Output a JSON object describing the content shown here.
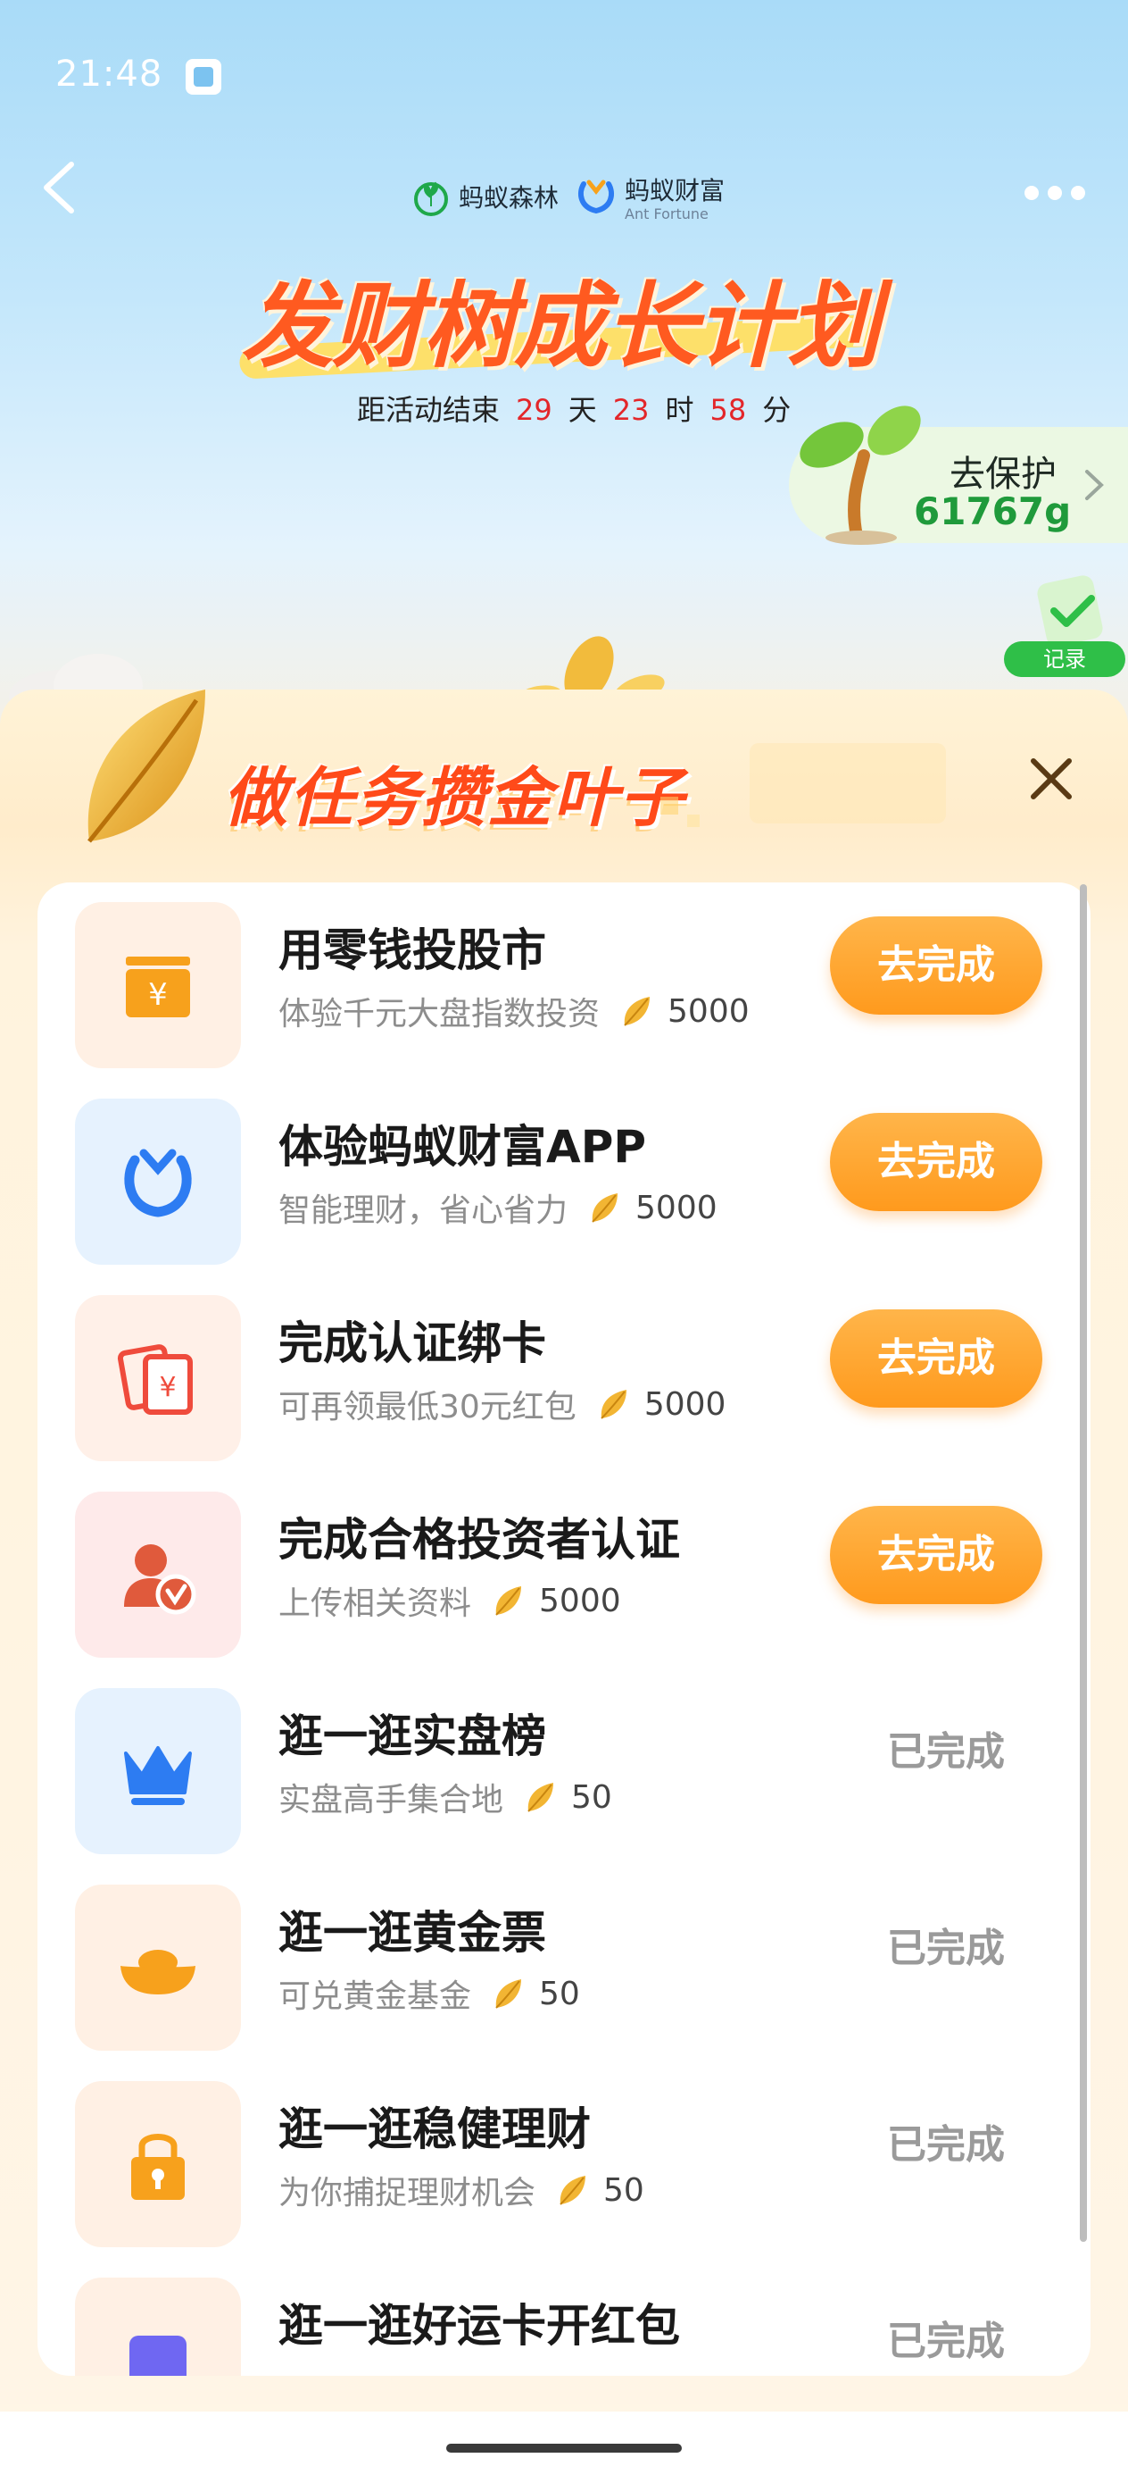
{
  "status_bar": {
    "time": "21:48"
  },
  "header": {
    "brand_forest": "蚂蚁森林",
    "brand_fortune": "蚂蚁财富",
    "brand_fortune_sub": "Ant Fortune",
    "title": "发财树成长计划",
    "countdown": {
      "prefix": "距活动结束",
      "days": "29",
      "days_unit": "天",
      "hours": "23",
      "hours_unit": "时",
      "minutes": "58",
      "minutes_unit": "分"
    }
  },
  "protect": {
    "label": "去保护",
    "value": "61767g"
  },
  "record": {
    "label": "记录"
  },
  "panel": {
    "title": "做任务攒金叶子"
  },
  "tasks": [
    {
      "title": "用零钱投股市",
      "subtitle": "体验千元大盘指数投资",
      "reward": "5000",
      "action": "去完成",
      "done": false,
      "icon": "yen-box-icon",
      "bg": "#fff0e4"
    },
    {
      "title": "体验蚂蚁财富APP",
      "subtitle": "智能理财，省心省力",
      "reward": "5000",
      "action": "去完成",
      "done": false,
      "icon": "ant-fortune-icon",
      "bg": "#e6f2fe"
    },
    {
      "title": "完成认证绑卡",
      "subtitle": "可再领最低30元红包",
      "reward": "5000",
      "action": "去完成",
      "done": false,
      "icon": "red-envelope-icon",
      "bg": "#fff0e8"
    },
    {
      "title": "完成合格投资者认证",
      "subtitle": "上传相关资料",
      "reward": "5000",
      "action": "去完成",
      "done": false,
      "icon": "verified-user-icon",
      "bg": "#feeaea"
    },
    {
      "title": "逛一逛实盘榜",
      "subtitle": "实盘高手集合地",
      "reward": "50",
      "action": "已完成",
      "done": true,
      "icon": "crown-icon",
      "bg": "#e6f2fe"
    },
    {
      "title": "逛一逛黄金票",
      "subtitle": "可兑黄金基金",
      "reward": "50",
      "action": "已完成",
      "done": true,
      "icon": "gold-ingot-icon",
      "bg": "#fff0e4"
    },
    {
      "title": "逛一逛稳健理财",
      "subtitle": "为你捕捉理财机会",
      "reward": "50",
      "action": "已完成",
      "done": true,
      "icon": "lock-icon",
      "bg": "#fff0e4"
    },
    {
      "title": "逛一逛好运卡开红包",
      "subtitle": "",
      "reward": "",
      "action": "已完成",
      "done": true,
      "icon": "lucky-card-icon",
      "bg": "#fff0e4"
    }
  ]
}
